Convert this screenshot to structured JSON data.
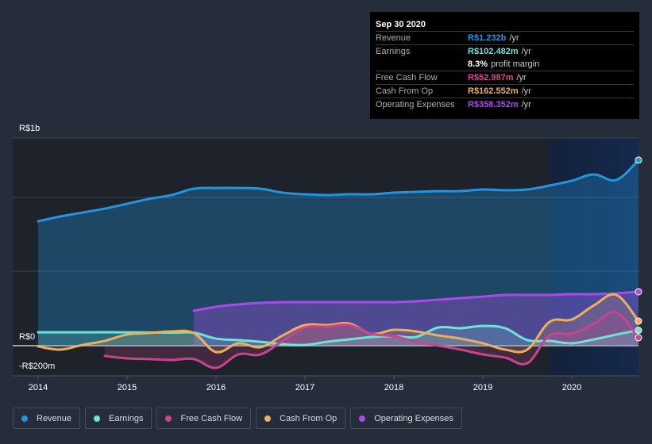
{
  "tooltip": {
    "date": "Sep 30 2020",
    "rows": [
      {
        "label": "Revenue",
        "value": "R$1.232b",
        "suffix": "/yr",
        "color": "#2394df"
      },
      {
        "label": "Earnings",
        "value": "R$102.482m",
        "suffix": "/yr",
        "color": "#6ce5d6"
      },
      {
        "label": "",
        "value": "8.3%",
        "suffix": "profit margin",
        "color": "#ffffff"
      },
      {
        "label": "Free Cash Flow",
        "value": "R$52.987m",
        "suffix": "/yr",
        "color": "#d44a93"
      },
      {
        "label": "Cash From Op",
        "value": "R$162.552m",
        "suffix": "/yr",
        "color": "#eeaf5d"
      },
      {
        "label": "Operating Expenses",
        "value": "R$358.352m",
        "suffix": "/yr",
        "color": "#a94ce6"
      }
    ]
  },
  "legend": [
    {
      "label": "Revenue",
      "color": "#2394df"
    },
    {
      "label": "Earnings",
      "color": "#6ce5d6"
    },
    {
      "label": "Free Cash Flow",
      "color": "#c8458d"
    },
    {
      "label": "Cash From Op",
      "color": "#eeaf5d"
    },
    {
      "label": "Operating Expenses",
      "color": "#a94ce6"
    }
  ],
  "chart_data": {
    "type": "area",
    "title": "",
    "xlabel": "",
    "ylabel": "",
    "units": "R$ millions",
    "x_ticks": [
      "2014",
      "2015",
      "2016",
      "2017",
      "2018",
      "2019",
      "2020"
    ],
    "y_tick_labels": [
      "R$1b",
      "R$0",
      "-R$200m"
    ],
    "xlim": [
      2013.7,
      2020.75
    ],
    "ylim": [
      -200,
      1400
    ],
    "forecast_shade_from": 2019.75,
    "grid": true,
    "legend_position": "bottom",
    "series": [
      {
        "name": "Revenue",
        "color": "#2394df",
        "x": [
          2014.0,
          2014.25,
          2014.5,
          2014.75,
          2015.0,
          2015.25,
          2015.5,
          2015.75,
          2016.0,
          2016.25,
          2016.5,
          2016.75,
          2017.0,
          2017.25,
          2017.5,
          2017.75,
          2018.0,
          2018.25,
          2018.5,
          2018.75,
          2019.0,
          2019.25,
          2019.5,
          2019.75,
          2020.0,
          2020.25,
          2020.5,
          2020.75
        ],
        "values": [
          826,
          858,
          884,
          910,
          942,
          975,
          1000,
          1042,
          1047,
          1047,
          1042,
          1016,
          1005,
          1000,
          1005,
          1005,
          1016,
          1021,
          1026,
          1026,
          1037,
          1032,
          1037,
          1063,
          1095,
          1137,
          1100,
          1232
        ]
      },
      {
        "name": "Earnings",
        "color": "#6ce5d6",
        "x": [
          2014.0,
          2014.5,
          2015.0,
          2015.5,
          2015.75,
          2016.0,
          2016.25,
          2016.5,
          2016.75,
          2017.0,
          2017.25,
          2017.5,
          2017.75,
          2018.0,
          2018.25,
          2018.5,
          2018.75,
          2019.0,
          2019.25,
          2019.5,
          2019.75,
          2020.0,
          2020.25,
          2020.5,
          2020.75
        ],
        "values": [
          89,
          89,
          89,
          86,
          86,
          47,
          37,
          26,
          10,
          5,
          26,
          42,
          58,
          63,
          58,
          121,
          116,
          131,
          116,
          37,
          32,
          16,
          42,
          74,
          102
        ]
      },
      {
        "name": "Free Cash Flow",
        "color": "#c8458d",
        "x": [
          2014.75,
          2015.0,
          2015.25,
          2015.5,
          2015.75,
          2016.0,
          2016.25,
          2016.5,
          2016.75,
          2017.0,
          2017.25,
          2017.5,
          2017.75,
          2018.0,
          2018.25,
          2018.5,
          2018.75,
          2019.0,
          2019.25,
          2019.5,
          2019.75,
          2020.0,
          2020.25,
          2020.5,
          2020.75
        ],
        "values": [
          -68,
          -84,
          -89,
          -95,
          -89,
          -147,
          -58,
          -58,
          32,
          121,
          126,
          137,
          79,
          63,
          26,
          0,
          -26,
          -58,
          -79,
          -116,
          68,
          79,
          147,
          221,
          53
        ]
      },
      {
        "name": "Cash From Op",
        "color": "#eeaf5d",
        "x": [
          2014.0,
          2014.25,
          2014.5,
          2014.75,
          2015.0,
          2015.25,
          2015.5,
          2015.75,
          2016.0,
          2016.25,
          2016.5,
          2016.75,
          2017.0,
          2017.25,
          2017.5,
          2017.75,
          2018.0,
          2018.25,
          2018.5,
          2018.75,
          2019.0,
          2019.25,
          2019.5,
          2019.75,
          2020.0,
          2020.25,
          2020.5,
          2020.75
        ],
        "values": [
          -5,
          -26,
          5,
          32,
          74,
          84,
          95,
          84,
          -42,
          16,
          -10,
          68,
          137,
          137,
          147,
          79,
          105,
          95,
          68,
          47,
          16,
          -26,
          -26,
          158,
          174,
          268,
          337,
          163
        ]
      },
      {
        "name": "Operating Expenses",
        "color": "#a94ce6",
        "x": [
          2015.75,
          2016.0,
          2016.25,
          2016.5,
          2016.75,
          2017.0,
          2017.25,
          2017.5,
          2017.75,
          2018.0,
          2018.25,
          2018.5,
          2018.75,
          2019.0,
          2019.25,
          2019.5,
          2019.75,
          2020.0,
          2020.25,
          2020.5,
          2020.75
        ],
        "values": [
          232,
          258,
          274,
          284,
          289,
          289,
          289,
          289,
          289,
          289,
          295,
          305,
          316,
          326,
          337,
          337,
          337,
          342,
          342,
          347,
          358
        ]
      }
    ]
  }
}
